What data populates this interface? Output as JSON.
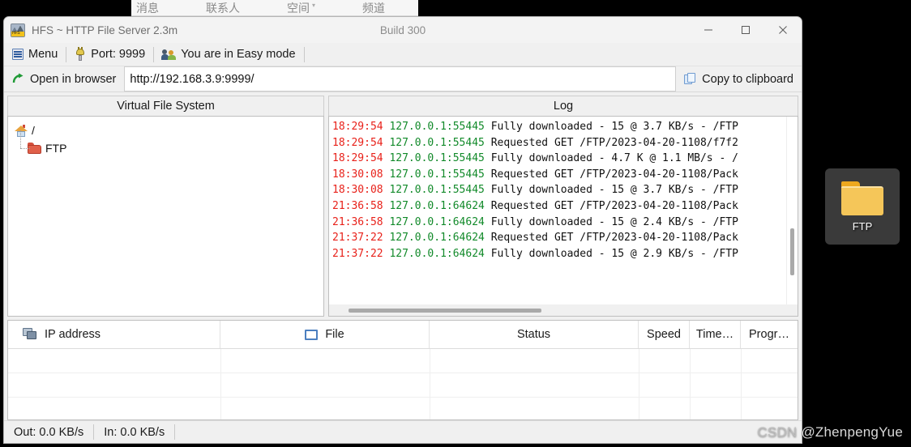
{
  "background_window": {
    "tabs": [
      {
        "label": "消息",
        "has_chevron": false
      },
      {
        "label": "联系人",
        "has_chevron": false
      },
      {
        "label": "空间",
        "has_chevron": true
      },
      {
        "label": "频道",
        "has_chevron": false
      }
    ]
  },
  "desktop": {
    "icon": {
      "name": "FTP",
      "icon": "folder-icon",
      "selected": true
    }
  },
  "window": {
    "title": "HFS ~ HTTP File Server 2.3m",
    "build": "Build 300",
    "app_icon": "hfs-icon",
    "controls": {
      "minimize": "minimize-icon",
      "maximize": "maximize-icon",
      "close": "close-icon"
    }
  },
  "menubar": {
    "menu": {
      "label": "Menu",
      "icon": "menu-icon"
    },
    "port": {
      "label": "Port: 9999",
      "icon": "plug-icon"
    },
    "mode": {
      "label": "You are in Easy mode",
      "icon": "users-icon"
    }
  },
  "addressbar": {
    "open_in_browser": {
      "label": "Open in browser",
      "icon": "arrow-icon"
    },
    "url": {
      "value": "http://192.168.3.9:9999/",
      "placeholder": ""
    },
    "copy": {
      "label": "Copy to clipboard",
      "icon": "copy-icon"
    }
  },
  "vfs": {
    "title": "Virtual File System",
    "nodes": [
      {
        "label": "/",
        "icon": "home-icon",
        "depth": 0
      },
      {
        "label": "FTP",
        "icon": "folder-icon",
        "depth": 1
      }
    ]
  },
  "log": {
    "title": "Log",
    "lines": [
      {
        "time": "18:29:54",
        "ip": "127.0.0.1:55445",
        "message": "Fully downloaded - 15 @ 3.7 KB/s - /FTP"
      },
      {
        "time": "18:29:54",
        "ip": "127.0.0.1:55445",
        "message": "Requested GET /FTP/2023-04-20-1108/f7f2"
      },
      {
        "time": "18:29:54",
        "ip": "127.0.0.1:55445",
        "message": "Fully downloaded - 4.7 K @ 1.1 MB/s - /"
      },
      {
        "time": "18:30:08",
        "ip": "127.0.0.1:55445",
        "message": "Requested GET /FTP/2023-04-20-1108/Pack"
      },
      {
        "time": "18:30:08",
        "ip": "127.0.0.1:55445",
        "message": "Fully downloaded - 15 @ 3.7 KB/s - /FTP"
      },
      {
        "time": "21:36:58",
        "ip": "127.0.0.1:64624",
        "message": "Requested GET /FTP/2023-04-20-1108/Pack"
      },
      {
        "time": "21:36:58",
        "ip": "127.0.0.1:64624",
        "message": "Fully downloaded - 15 @ 2.4 KB/s - /FTP"
      },
      {
        "time": "21:37:22",
        "ip": "127.0.0.1:64624",
        "message": "Requested GET /FTP/2023-04-20-1108/Pack"
      },
      {
        "time": "21:37:22",
        "ip": "127.0.0.1:64624",
        "message": "Fully downloaded - 15 @ 2.9 KB/s - /FTP"
      }
    ]
  },
  "transfers": {
    "columns": [
      {
        "label": "IP address",
        "icon": "monitor-icon"
      },
      {
        "label": "File",
        "icon": "window-icon"
      },
      {
        "label": "Status",
        "icon": ""
      },
      {
        "label": "Speed",
        "icon": ""
      },
      {
        "label": "Time…",
        "icon": ""
      },
      {
        "label": "Progr…",
        "icon": ""
      }
    ],
    "rows": []
  },
  "statusbar": {
    "out": "Out: 0.0 KB/s",
    "in": "In: 0.0 KB/s"
  },
  "watermark": {
    "prefix": "CSDN",
    "text": " @ZhenpengYue"
  },
  "colors": {
    "log_time": "#e8211a",
    "log_ip": "#128a2a",
    "log_message": "#111111",
    "window_chrome": "#f0f0f0",
    "desktop": "#000000"
  }
}
